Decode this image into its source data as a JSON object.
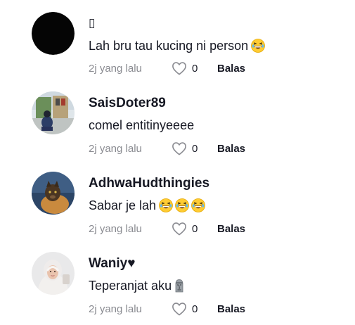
{
  "comments": [
    {
      "username": "▯",
      "text": "Lah bru tau kucing ni person",
      "emojis": [
        "laughing-emoji"
      ],
      "time": "2j yang lalu",
      "likes": "0",
      "reply_label": "Balas"
    },
    {
      "username": "SaisDoter89",
      "text": "comel entitinyeeee",
      "emojis": [],
      "time": "2j yang lalu",
      "likes": "0",
      "reply_label": "Balas"
    },
    {
      "username": "AdhwaHudthingies",
      "text": "Sabar je lah",
      "emojis": [
        "laughing-emoji",
        "laughing-emoji",
        "laughing-emoji"
      ],
      "time": "2j yang lalu",
      "likes": "0",
      "reply_label": "Balas"
    },
    {
      "username": "Waniy♥",
      "text": "Teperanjat aku",
      "emojis": [
        "moai-emoji"
      ],
      "time": "2j yang lalu",
      "likes": "0",
      "reply_label": "Balas"
    }
  ],
  "icons": {
    "like": "heart-outline-icon"
  },
  "colors": {
    "meta_text": "#8a8b91",
    "primary_text": "#161823"
  }
}
